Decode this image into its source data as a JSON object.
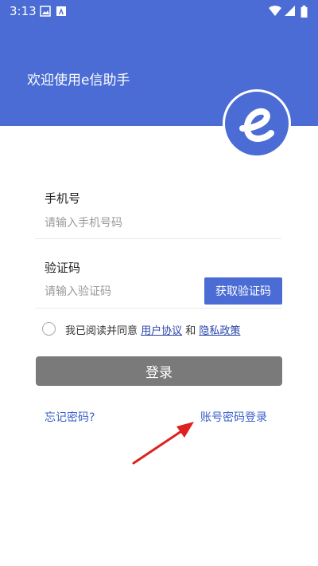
{
  "status_bar": {
    "time": "3:13"
  },
  "header": {
    "welcome_text": "欢迎使用e信助手"
  },
  "phone": {
    "label": "手机号",
    "placeholder": "请输入手机号码",
    "value": ""
  },
  "code": {
    "label": "验证码",
    "placeholder": "请输入验证码",
    "value": "",
    "get_code_label": "获取验证码"
  },
  "agreement": {
    "prefix": "我已阅读并同意 ",
    "user_agreement": "用户协议",
    "and": " 和 ",
    "privacy_policy": "隐私政策",
    "checked": false
  },
  "login_button": {
    "label": "登录"
  },
  "links": {
    "forgot_password": "忘记密码?",
    "account_login": "账号密码登录"
  },
  "colors": {
    "brand": "#4a6cd4",
    "login_disabled": "#7a7a7a",
    "link": "#3a5fc8",
    "arrow": "#e02020"
  }
}
